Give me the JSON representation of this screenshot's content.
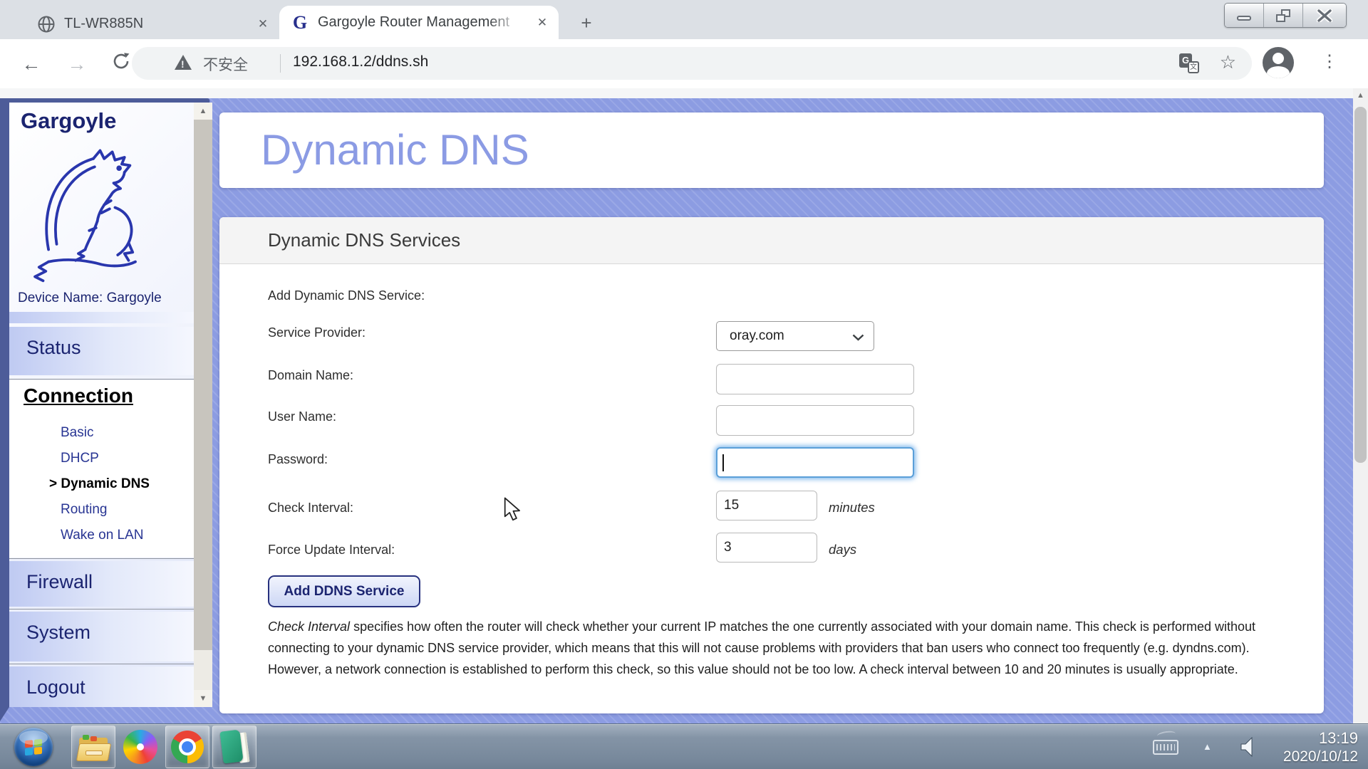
{
  "browser": {
    "tabs": [
      {
        "title": "TL-WR885N"
      },
      {
        "title": "Gargoyle Router Management",
        "active": true
      }
    ],
    "address": {
      "security_label": "不安全",
      "url": "192.168.1.2/ddns.sh"
    },
    "window_controls": [
      "minimize",
      "restore",
      "close"
    ]
  },
  "icons": {
    "close": "✕",
    "plus": "+",
    "back": "←",
    "forward": "→",
    "star": "☆",
    "dots": "⋮",
    "caret_up": "▲",
    "caret_down": "▼",
    "tray_up": "▲",
    "translate_back": "G",
    "translate_front": "文"
  },
  "colors": {
    "periwinkle_bg": "#8c9ce2",
    "navy_frame": "#4d5c99",
    "navy_text": "#1b2470",
    "title_blue": "#8b9be4",
    "focus_blue": "#5b9fd8",
    "link_blue": "#283593"
  },
  "sidebar": {
    "brand": "Gargoyle",
    "device_name": "Device Name: Gargoyle",
    "active_prefix": "> ",
    "sections": [
      {
        "label": "Status"
      },
      {
        "label": "Connection",
        "items": [
          {
            "label": "Basic"
          },
          {
            "label": "DHCP"
          },
          {
            "label": "Dynamic DNS",
            "active": true
          },
          {
            "label": "Routing"
          },
          {
            "label": "Wake on LAN"
          }
        ]
      },
      {
        "label": "Firewall"
      },
      {
        "label": "System"
      },
      {
        "label": "Logout"
      }
    ]
  },
  "main": {
    "page_title": "Dynamic DNS",
    "panel_title": "Dynamic DNS Services",
    "form": {
      "intro": "Add Dynamic DNS Service:",
      "rows": [
        {
          "label": "Service Provider:",
          "control": "select",
          "value": "oray.com"
        },
        {
          "label": "Domain Name:",
          "control": "input",
          "value": ""
        },
        {
          "label": "User Name:",
          "control": "input",
          "value": ""
        },
        {
          "label": "Password:",
          "control": "input",
          "value": "",
          "focused": true
        },
        {
          "label": "Check Interval:",
          "control": "input-small",
          "value": "15",
          "suffix": "minutes"
        },
        {
          "label": "Force Update Interval:",
          "control": "input-small",
          "value": "3",
          "suffix": "days"
        }
      ],
      "submit_label": "Add DDNS Service"
    },
    "help": {
      "lead": "Check Interval",
      "body": " specifies how often the router will check whether your current IP matches the one currently associated with your domain name. This check is performed without connecting to your dynamic DNS service provider, which means that this will not cause problems with providers that ban users who connect too frequently (e.g. dyndns.com). However, a network connection is established to perform this check, so this value should not be too low. A check interval between 10 and 20 minutes is usually appropriate."
    }
  },
  "taskbar": {
    "clock_time": "13:19",
    "clock_date": "2020/10/12"
  }
}
